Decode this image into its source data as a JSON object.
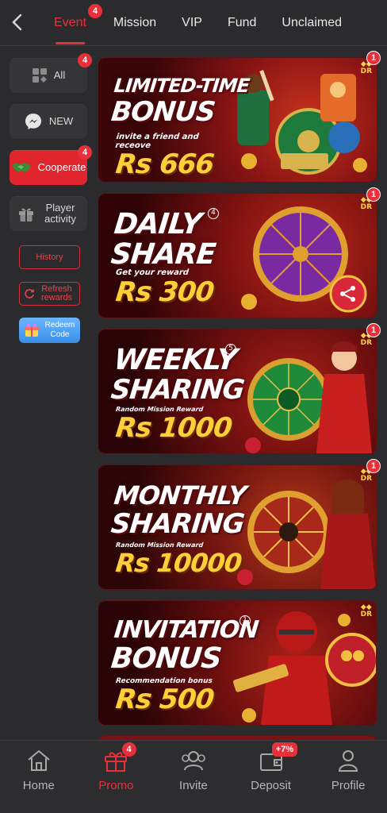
{
  "header": {
    "tabs": [
      {
        "label": "Event",
        "badge": "4",
        "active": true
      },
      {
        "label": "Mission"
      },
      {
        "label": "VIP"
      },
      {
        "label": "Fund"
      },
      {
        "label": "Unclaimed"
      }
    ]
  },
  "sidebar": {
    "items": [
      {
        "label": "All",
        "badge": "4",
        "icon": "grid-icon"
      },
      {
        "label": "NEW",
        "icon": "messenger-icon"
      },
      {
        "label": "Cooperate",
        "badge": "4",
        "icon": "handshake-icon",
        "active": true
      },
      {
        "label": "Player activity",
        "icon": "gift-icon"
      }
    ],
    "history_label": "History",
    "refresh_label": "Refresh rewards",
    "redeem_label": "Redeem Code"
  },
  "banners": [
    {
      "title_line1": "LIMITED-TIME",
      "title_line2": "BONUS",
      "sub": "invite a friend and receove",
      "amount": "Rs 666",
      "badge": "1"
    },
    {
      "title_line1": "DAILY",
      "title_line2": "SHARE",
      "sub": "Get your reward",
      "amount": "Rs 300",
      "badge": "1",
      "num": "4"
    },
    {
      "title_line1": "WEEKLY",
      "title_line2": "SHARING",
      "sub": "Random Mission Reward",
      "amount": "Rs 1000",
      "badge": "1",
      "num": "5"
    },
    {
      "title_line1": "MONTHLY",
      "title_line2": "SHARING",
      "sub": "Random Mission Reward",
      "amount": "Rs 10000",
      "badge": "1"
    },
    {
      "title_line1": "INVITATION",
      "title_line2": "BONUS",
      "sub": "Recommendation bonus",
      "amount": "Rs 500",
      "num": "1"
    }
  ],
  "bottom_nav": {
    "items": [
      {
        "label": "Home",
        "icon": "home-icon"
      },
      {
        "label": "Promo",
        "icon": "gift-icon",
        "badge": "4",
        "active": true
      },
      {
        "label": "Invite",
        "icon": "people-icon"
      },
      {
        "label": "Deposit",
        "icon": "wallet-icon",
        "badge": "+7%"
      },
      {
        "label": "Profile",
        "icon": "person-icon"
      }
    ]
  },
  "colors": {
    "accent": "#e8303a",
    "background": "#2b2b2d",
    "gold": "#ffcf3a"
  }
}
